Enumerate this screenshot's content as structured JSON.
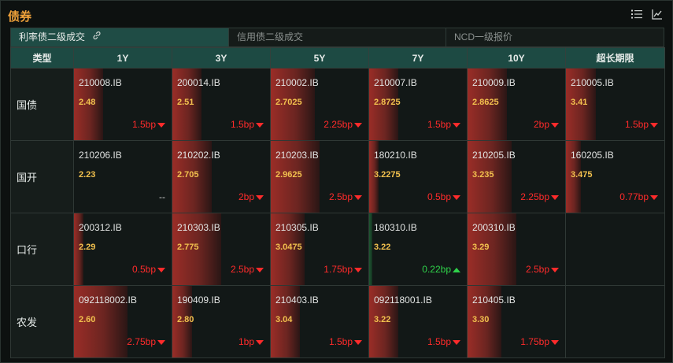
{
  "header": {
    "title": "债券",
    "list_icon": "list-icon",
    "chart_icon": "line-chart-icon"
  },
  "tabs": [
    {
      "label": "利率债二级成交",
      "active": true,
      "icon": "link-icon"
    },
    {
      "label": "信用债二级成交",
      "active": false
    },
    {
      "label": "NCD一级报价",
      "active": false
    }
  ],
  "columns": [
    "类型",
    "1Y",
    "3Y",
    "5Y",
    "7Y",
    "10Y",
    "超长期限"
  ],
  "colors": {
    "down": "#ff2b2b",
    "up": "#2fd24a",
    "yield": "#f2c14e",
    "header": "#1d4a43",
    "title": "#f0a23a"
  },
  "rows": [
    {
      "label": "国债",
      "cells": [
        {
          "code": "210008.IB",
          "yield": "2.48",
          "change": "1.5bp",
          "dir": "down",
          "level": 0.3
        },
        {
          "code": "200014.IB",
          "yield": "2.51",
          "change": "1.5bp",
          "dir": "down",
          "level": 0.3
        },
        {
          "code": "210002.IB",
          "yield": "2.7025",
          "change": "2.25bp",
          "dir": "down",
          "level": 0.45
        },
        {
          "code": "210007.IB",
          "yield": "2.8725",
          "change": "1.5bp",
          "dir": "down",
          "level": 0.3
        },
        {
          "code": "210009.IB",
          "yield": "2.8625",
          "change": "2bp",
          "dir": "down",
          "level": 0.4
        },
        {
          "code": "210005.IB",
          "yield": "3.41",
          "change": "1.5bp",
          "dir": "down",
          "level": 0.3
        }
      ]
    },
    {
      "label": "国开",
      "cells": [
        {
          "code": "210206.IB",
          "yield": "2.23",
          "change": "--",
          "dir": "flat",
          "level": 0
        },
        {
          "code": "210202.IB",
          "yield": "2.705",
          "change": "2bp",
          "dir": "down",
          "level": 0.4
        },
        {
          "code": "210203.IB",
          "yield": "2.9625",
          "change": "2.5bp",
          "dir": "down",
          "level": 0.5
        },
        {
          "code": "180210.IB",
          "yield": "3.2275",
          "change": "0.5bp",
          "dir": "down",
          "level": 0.1
        },
        {
          "code": "210205.IB",
          "yield": "3.235",
          "change": "2.25bp",
          "dir": "down",
          "level": 0.45
        },
        {
          "code": "160205.IB",
          "yield": "3.475",
          "change": "0.77bp",
          "dir": "down",
          "level": 0.15
        }
      ]
    },
    {
      "label": "口行",
      "cells": [
        {
          "code": "200312.IB",
          "yield": "2.29",
          "change": "0.5bp",
          "dir": "down",
          "level": 0.1
        },
        {
          "code": "210303.IB",
          "yield": "2.775",
          "change": "2.5bp",
          "dir": "down",
          "level": 0.5
        },
        {
          "code": "210305.IB",
          "yield": "3.0475",
          "change": "1.75bp",
          "dir": "down",
          "level": 0.35
        },
        {
          "code": "180310.IB",
          "yield": "3.22",
          "change": "0.22bp",
          "dir": "up",
          "level": 0.04
        },
        {
          "code": "200310.IB",
          "yield": "3.29",
          "change": "2.5bp",
          "dir": "down",
          "level": 0.5
        },
        null
      ]
    },
    {
      "label": "农发",
      "cells": [
        {
          "code": "092118002.IB",
          "yield": "2.60",
          "change": "2.75bp",
          "dir": "down",
          "level": 0.55
        },
        {
          "code": "190409.IB",
          "yield": "2.80",
          "change": "1bp",
          "dir": "down",
          "level": 0.2
        },
        {
          "code": "210403.IB",
          "yield": "3.04",
          "change": "1.5bp",
          "dir": "down",
          "level": 0.3
        },
        {
          "code": "092118001.IB",
          "yield": "3.22",
          "change": "1.5bp",
          "dir": "down",
          "level": 0.3
        },
        {
          "code": "210405.IB",
          "yield": "3.30",
          "change": "1.75bp",
          "dir": "down",
          "level": 0.35
        },
        null
      ]
    }
  ]
}
